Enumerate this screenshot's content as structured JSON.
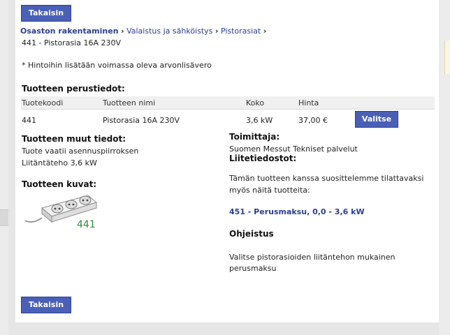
{
  "nav": {
    "back_label": "Takaisin",
    "back_label_bottom": "Takaisin"
  },
  "breadcrumb": {
    "items": [
      "Osaston rakentaminen",
      "Valaistus ja sähköistys",
      "Pistorasiat"
    ],
    "current": "441 - Pistorasia 16A 230V",
    "separator": "›"
  },
  "vat_note": "* Hintoihin lisätään voimassa oleva arvonlisävero",
  "basic_info": {
    "title": "Tuotteen perustiedot:",
    "columns": [
      "Tuotekoodi",
      "Tuotteen nimi",
      "Koko",
      "Hinta"
    ],
    "row": {
      "code": "441",
      "name": "Pistorasia 16A 230V",
      "size": "3,6 kW",
      "price": "37,00 €",
      "select_label": "Valitse"
    }
  },
  "other_info": {
    "title": "Tuotteen muut tiedot:",
    "lines": [
      "Tuote vaatii asennuspiirroksen",
      "Liitäntäteho 3,6 kW"
    ]
  },
  "images": {
    "title": "Tuotteen kuvat:",
    "caption": "441"
  },
  "supplier": {
    "title": "Toimittaja:",
    "name": "Suomen Messut Tekniset palvelut"
  },
  "attachments": {
    "title": "Liitetiedostot:"
  },
  "recommend": {
    "text_line1": "Tämän tuotteen kanssa suosittelemme tilattavaksi",
    "text_line2": "myös näitä tuotteita:",
    "link": "451 - Perusmaksu, 0,0 - 3,6 kW"
  },
  "guidance": {
    "title": "Ohjeistus",
    "line1": "Valitse pistorasioiden liitäntehon mukainen",
    "line2": "perusmaksu"
  },
  "colors": {
    "button": "#4a5fb6",
    "link": "#2b3f8c",
    "caption": "#2e8b3a"
  }
}
